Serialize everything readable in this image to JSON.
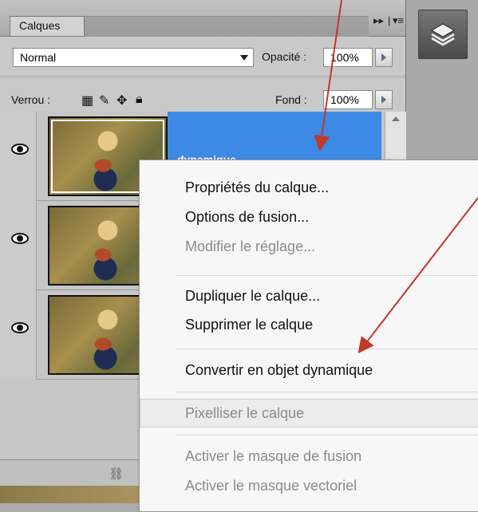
{
  "panel": {
    "tab_label": "Calques",
    "blend_mode": "Normal",
    "opacity_label": "Opacité :",
    "opacity_value": "100%",
    "lock_label": "Verrou :",
    "fill_label": "Fond :",
    "fill_value": "100%",
    "selected_layer_name": "dynamique",
    "header_buttons": [
      "▸▸",
      "|",
      "▾≡"
    ]
  },
  "layers": [
    {
      "visible": true,
      "selected": true
    },
    {
      "visible": true,
      "selected": false
    },
    {
      "visible": true,
      "selected": false
    }
  ],
  "context_menu": {
    "items": [
      {
        "label": "Propriétés du calque...",
        "enabled": true
      },
      {
        "label": "Options de fusion...",
        "enabled": true
      },
      {
        "label": "Modifier le réglage...",
        "enabled": false
      },
      {
        "label": "Dupliquer le calque...",
        "enabled": true
      },
      {
        "label": "Supprimer le calque",
        "enabled": true
      },
      {
        "label": "Convertir en objet dynamique",
        "enabled": true
      },
      {
        "label": "Pixelliser le calque",
        "enabled": false
      },
      {
        "label": "Activer le masque de fusion",
        "enabled": false
      },
      {
        "label": "Activer le masque vectoriel",
        "enabled": false
      }
    ]
  },
  "colors": {
    "selection": "#3d8ae6",
    "annotation_arrow": "#c0392b"
  },
  "icons": [
    "eye-icon",
    "lock-transparent-icon",
    "brush-icon",
    "move-icon",
    "lock-icon",
    "link-icon",
    "layers-icon",
    "scroll-up-icon",
    "panel-menu-icon"
  ]
}
